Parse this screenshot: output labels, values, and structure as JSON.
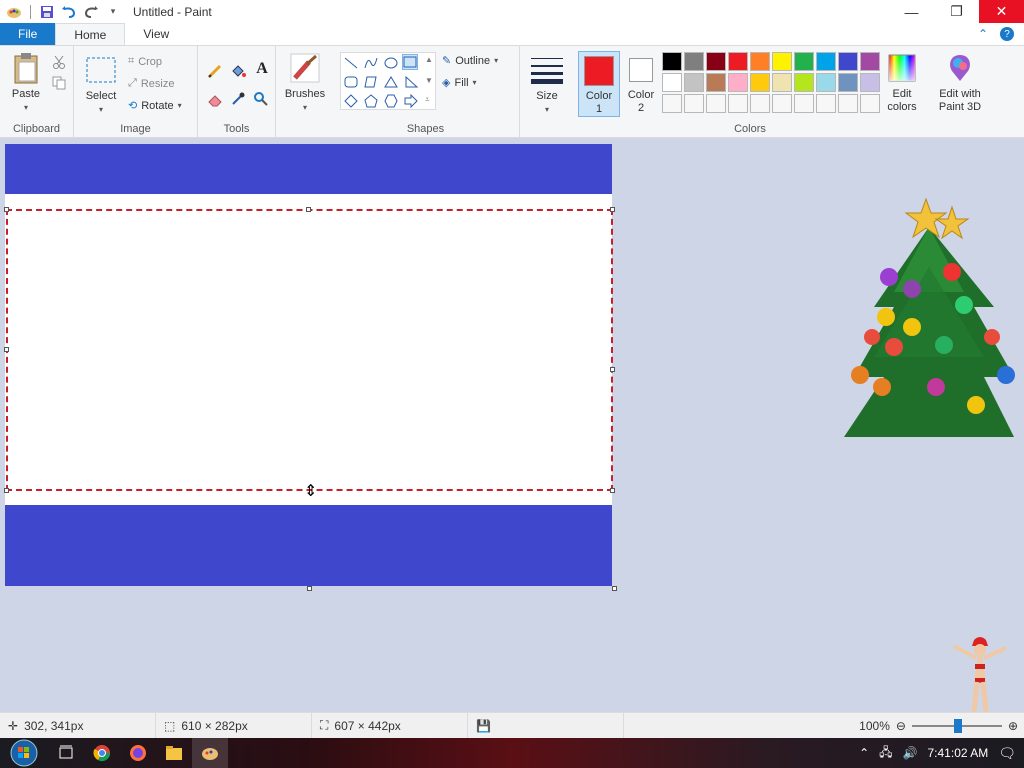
{
  "window": {
    "title": "Untitled - Paint",
    "controls": {
      "minimize": "—",
      "maximize": "❐",
      "close": "✕"
    }
  },
  "tabs": [
    {
      "label": "File"
    },
    {
      "label": "Home"
    },
    {
      "label": "View"
    }
  ],
  "ribbon": {
    "clipboard": {
      "label": "Clipboard",
      "paste": "Paste"
    },
    "image": {
      "label": "Image",
      "select": "Select",
      "crop": "Crop",
      "resize": "Resize",
      "rotate": "Rotate"
    },
    "tools": {
      "label": "Tools"
    },
    "brushes": {
      "label": "Brushes"
    },
    "shapes": {
      "label": "Shapes",
      "outline": "Outline",
      "fill": "Fill"
    },
    "size": {
      "label": "Size"
    },
    "colors": {
      "label": "Colors",
      "color1_label": "Color",
      "color1_num": "1",
      "color2_label": "Color",
      "color2_num": "2",
      "edit_colors": "Edit colors",
      "edit_colors_l1": "Edit",
      "edit_colors_l2": "colors",
      "paint3d_l1": "Edit with",
      "paint3d_l2": "Paint 3D",
      "color1_value": "#ed1c24",
      "color2_value": "#ffffff",
      "palette": [
        "#000000",
        "#7f7f7f",
        "#880015",
        "#ed1c24",
        "#ff7f27",
        "#fff200",
        "#22b14c",
        "#00a2e8",
        "#3f48cc",
        "#a349a4",
        "#ffffff",
        "#c3c3c3",
        "#b97a57",
        "#ffaec9",
        "#ffc90e",
        "#efe4b0",
        "#b5e61d",
        "#99d9ea",
        "#7092be",
        "#c8bfe7",
        "#ffffff",
        "#ffffff",
        "#ffffff",
        "#ffffff",
        "#ffffff",
        "#ffffff",
        "#ffffff",
        "#ffffff",
        "#ffffff",
        "#ffffff"
      ]
    }
  },
  "canvas": {
    "band_color": "#3f48cc"
  },
  "statusbar": {
    "cursor_pos": "302, 341px",
    "selection_size": "610 × 282px",
    "image_size": "607 × 442px",
    "zoom": "100%"
  },
  "taskbar": {
    "time": "7:41:02 AM"
  }
}
